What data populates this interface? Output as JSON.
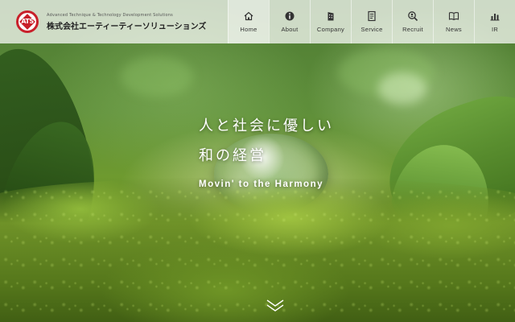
{
  "header": {
    "logo_text": "ATS",
    "tagline": "Advanced Technique & Technology Development Solutions",
    "company_name": "株式会社エーティーティーソリューションズ"
  },
  "nav": {
    "items": [
      {
        "label": "Home",
        "icon": "home-icon"
      },
      {
        "label": "About",
        "icon": "info-icon"
      },
      {
        "label": "Company",
        "icon": "building-icon"
      },
      {
        "label": "Service",
        "icon": "document-icon"
      },
      {
        "label": "Recruit",
        "icon": "search-person-icon"
      },
      {
        "label": "News",
        "icon": "book-icon"
      },
      {
        "label": "IR",
        "icon": "bar-chart-icon"
      }
    ],
    "active": "Home"
  },
  "hero": {
    "catch_line_1": "人と社会に優しい",
    "catch_line_2": "和の経営",
    "subtitle": "Movin' to the Harmony",
    "scroll_icon": "double-chevron-down-icon"
  },
  "colors": {
    "brand_red": "#c8202a",
    "header_bg": "rgba(255,255,255,0.72)",
    "text_dark": "#333333",
    "hero_text": "#ffffff"
  }
}
